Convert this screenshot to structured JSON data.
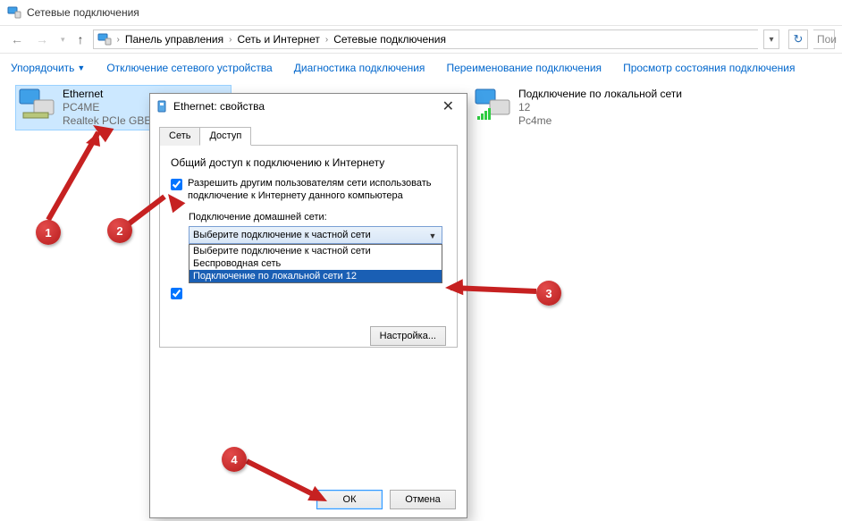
{
  "window": {
    "title": "Сетевые подключения"
  },
  "breadcrumb": {
    "items": [
      "Панель управления",
      "Сеть и Интернет",
      "Сетевые подключения"
    ]
  },
  "searchPlaceholder": "Пои",
  "commands": {
    "organize": "Упорядочить",
    "disable": "Отключение сетевого устройства",
    "diagnose": "Диагностика подключения",
    "rename": "Переименование подключения",
    "status": "Просмотр состояния подключения"
  },
  "connections": {
    "ethernet": {
      "name": "Ethernet",
      "domain": "PC4ME",
      "adapter": "Realtek PCIe GBE"
    },
    "lan": {
      "name": "Подключение по локальной сети",
      "line2": "12",
      "line3": "Pc4me"
    }
  },
  "dialog": {
    "title": "Ethernet: свойства",
    "tabs": {
      "network": "Сеть",
      "access": "Доступ"
    },
    "group": "Общий доступ к подключению к Интернету",
    "chk_allow": "Разрешить другим пользователям сети использовать подключение к Интернету данного компьютера",
    "home_label": "Подключение домашней сети:",
    "selected": "Выберите подключение к частной сети",
    "options": {
      "o1": "Выберите подключение к частной сети",
      "o2": "Беспроводная сеть",
      "o3": "Подключение по локальной сети 12"
    },
    "settings_btn": "Настройка...",
    "ok": "ОК",
    "cancel": "Отмена"
  },
  "badges": {
    "b1": "1",
    "b2": "2",
    "b3": "3",
    "b4": "4"
  }
}
